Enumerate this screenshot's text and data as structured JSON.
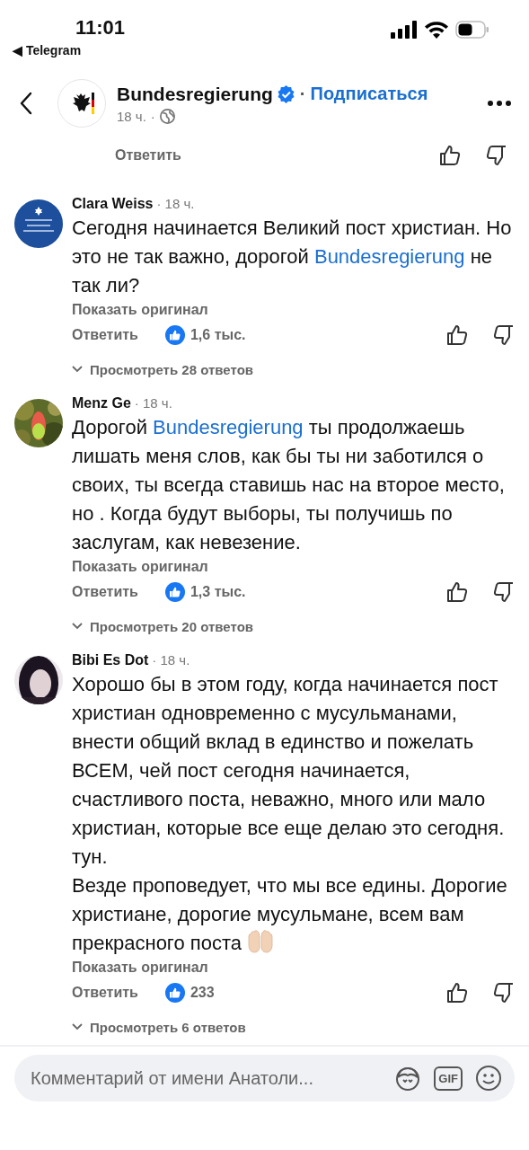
{
  "status_bar": {
    "time": "11:01",
    "back_app": "◀ Telegram"
  },
  "header": {
    "page_name": "Bundesregierung",
    "verified": true,
    "separator": "·",
    "follow": "Подписаться",
    "time": "18 ч.",
    "dot": "·"
  },
  "post_actions": {
    "reply": "Ответить"
  },
  "comments": [
    {
      "author": "Clara Weiss",
      "time": "· 18 ч.",
      "text": [
        {
          "text": "Сегодня начинается Великий пост христиан. Но это не так важно, дорогой ",
          "mention": false
        },
        {
          "text": "Bundesregierung",
          "mention": true
        },
        {
          "text": " не так ли?",
          "mention": false
        }
      ],
      "hands": false,
      "show_original": "Показать оригинал",
      "reply": "Ответить",
      "likes": "1,6 тыс.",
      "view_replies": "Просмотреть 28 ответов"
    },
    {
      "author": "Menz Ge",
      "time": "· 18 ч.",
      "text": [
        {
          "text": "Дорогой ",
          "mention": false
        },
        {
          "text": "Bundesregierung",
          "mention": true
        },
        {
          "text": " ты продолжаешь лишать меня слов, как бы ты ни заботился о своих, ты всегда ставишь нас на второе место, но . Когда будут выборы, ты получишь по заслугам, как невезение.",
          "mention": false
        }
      ],
      "hands": false,
      "show_original": "Показать оригинал",
      "reply": "Ответить",
      "likes": "1,3 тыс.",
      "view_replies": "Просмотреть 20 ответов"
    },
    {
      "author": "Bibi Es Dot",
      "time": "· 18 ч.",
      "text": [
        {
          "text": "Хорошо бы в этом году, когда начинается пост христиан одновременно с мусульманами, внести общий вклад в единство и пожелать ВСЕМ, чей пост сегодня начинается, счастливого поста, неважно, много или мало христиан, которые все еще делаю это сегодня. тун.\nВезде проповедует, что мы все едины. Дорогие христиане, дорогие мусульмане, всем вам прекрасного поста",
          "mention": false
        }
      ],
      "hands": true,
      "show_original": "Показать оригинал",
      "reply": "Ответить",
      "likes": "233",
      "view_replies": "Просмотреть 6 ответов"
    }
  ],
  "composer": {
    "placeholder": "Комментарий от имени Анатоли..."
  },
  "gif_label": "GIF"
}
